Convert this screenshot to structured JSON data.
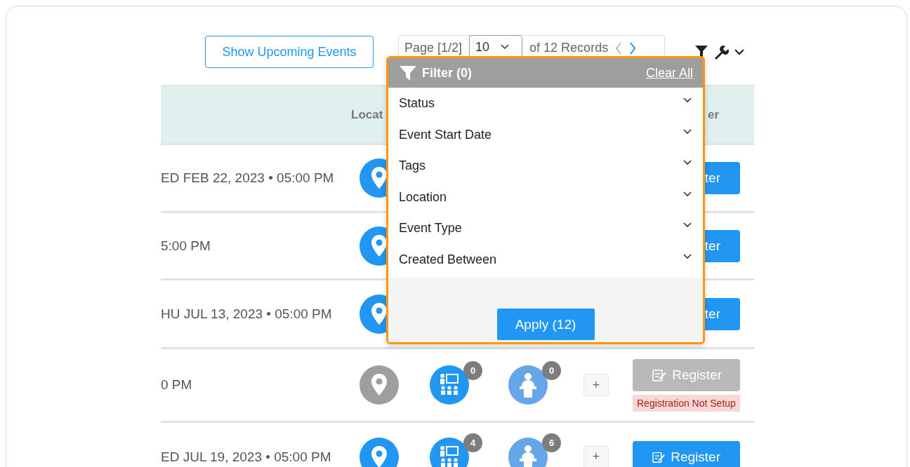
{
  "toolbar": {
    "upcoming_button": "Show Upcoming Events",
    "pagination": {
      "page": "Page [1/2]",
      "page_size": "10",
      "records": "of 12 Records",
      "prev_disabled": true,
      "next_disabled": false
    }
  },
  "table": {
    "columns": [
      "Locat",
      "er"
    ],
    "rows": [
      {
        "date": "ED FEB 22, 2023 • 05:00 PM",
        "location_disabled": false,
        "register": {
          "label": "ter",
          "disabled": false
        }
      },
      {
        "date": "5:00 PM",
        "location_disabled": false,
        "register": {
          "label": "ter",
          "disabled": false
        }
      },
      {
        "date": "HU JUL 13, 2023 • 05:00 PM",
        "location_disabled": false,
        "register": {
          "label": "ter",
          "disabled": false
        }
      },
      {
        "date": "0 PM",
        "location_disabled": true,
        "presenters": "0",
        "speakers": "0",
        "add": "+",
        "register": {
          "label": "Register",
          "disabled": true
        },
        "note": "Registration Not Setup"
      },
      {
        "date": "ED JUL 19, 2023 • 05:00 PM",
        "location_disabled": false,
        "presenters": "4",
        "speakers": "6",
        "add": "+",
        "register": {
          "label": "Register",
          "disabled": false
        }
      }
    ]
  },
  "filter_panel": {
    "title": "Filter (0)",
    "clear": "Clear All",
    "items": [
      "Status",
      "Event Start Date",
      "Tags",
      "Location",
      "Event Type",
      "Created Between"
    ],
    "apply": "Apply (12)"
  }
}
